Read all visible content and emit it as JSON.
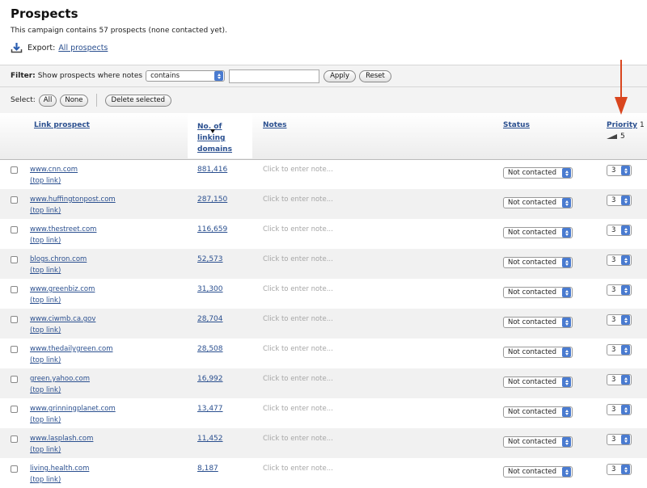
{
  "header": {
    "title": "Prospects",
    "subtitle": "This campaign contains 57 prospects (none contacted yet).",
    "export_label": "Export:",
    "export_link": "All prospects",
    "export_icon": "download-icon"
  },
  "filter": {
    "label": "Filter:",
    "text": "Show prospects where notes",
    "operator": "contains",
    "value": "",
    "apply": "Apply",
    "reset": "Reset"
  },
  "selection": {
    "label": "Select:",
    "all": "All",
    "none": "None",
    "delete": "Delete selected"
  },
  "columns": {
    "link_prospect": "Link prospect",
    "linking_line1": "No. of",
    "linking_line2": "linking",
    "linking_line3": "domains",
    "notes": "Notes",
    "status": "Status",
    "priority": "Priority",
    "priority_high": "1",
    "priority_low": "5"
  },
  "colors": {
    "link": "#2a4f8f",
    "arrow": "#d9451e",
    "spinner": "#4a7bd0"
  },
  "rows": [
    {
      "domain": "www.cnn.com",
      "top_link": "(top link)",
      "count": "881,416",
      "note": "Click to enter note...",
      "status": "Not contacted",
      "priority": "3"
    },
    {
      "domain": "www.huffingtonpost.com",
      "top_link": "(top link)",
      "count": "287,150",
      "note": "Click to enter note...",
      "status": "Not contacted",
      "priority": "3"
    },
    {
      "domain": "www.thestreet.com",
      "top_link": "(top link)",
      "count": "116,659",
      "note": "Click to enter note...",
      "status": "Not contacted",
      "priority": "3"
    },
    {
      "domain": "blogs.chron.com",
      "top_link": "(top link)",
      "count": "52,573",
      "note": "Click to enter note...",
      "status": "Not contacted",
      "priority": "3"
    },
    {
      "domain": "www.greenbiz.com",
      "top_link": "(top link)",
      "count": "31,300",
      "note": "Click to enter note...",
      "status": "Not contacted",
      "priority": "3"
    },
    {
      "domain": "www.ciwmb.ca.gov",
      "top_link": "(top link)",
      "count": "28,704",
      "note": "Click to enter note...",
      "status": "Not contacted",
      "priority": "3"
    },
    {
      "domain": "www.thedailygreen.com",
      "top_link": "(top link)",
      "count": "28,508",
      "note": "Click to enter note...",
      "status": "Not contacted",
      "priority": "3"
    },
    {
      "domain": "green.yahoo.com",
      "top_link": "(top link)",
      "count": "16,992",
      "note": "Click to enter note...",
      "status": "Not contacted",
      "priority": "3"
    },
    {
      "domain": "www.grinningplanet.com",
      "top_link": "(top link)",
      "count": "13,477",
      "note": "Click to enter note...",
      "status": "Not contacted",
      "priority": "3"
    },
    {
      "domain": "www.lasplash.com",
      "top_link": "(top link)",
      "count": "11,452",
      "note": "Click to enter note...",
      "status": "Not contacted",
      "priority": "3"
    },
    {
      "domain": "living.health.com",
      "top_link": "(top link)",
      "count": "8,187",
      "note": "Click to enter note...",
      "status": "Not contacted",
      "priority": "3"
    }
  ]
}
